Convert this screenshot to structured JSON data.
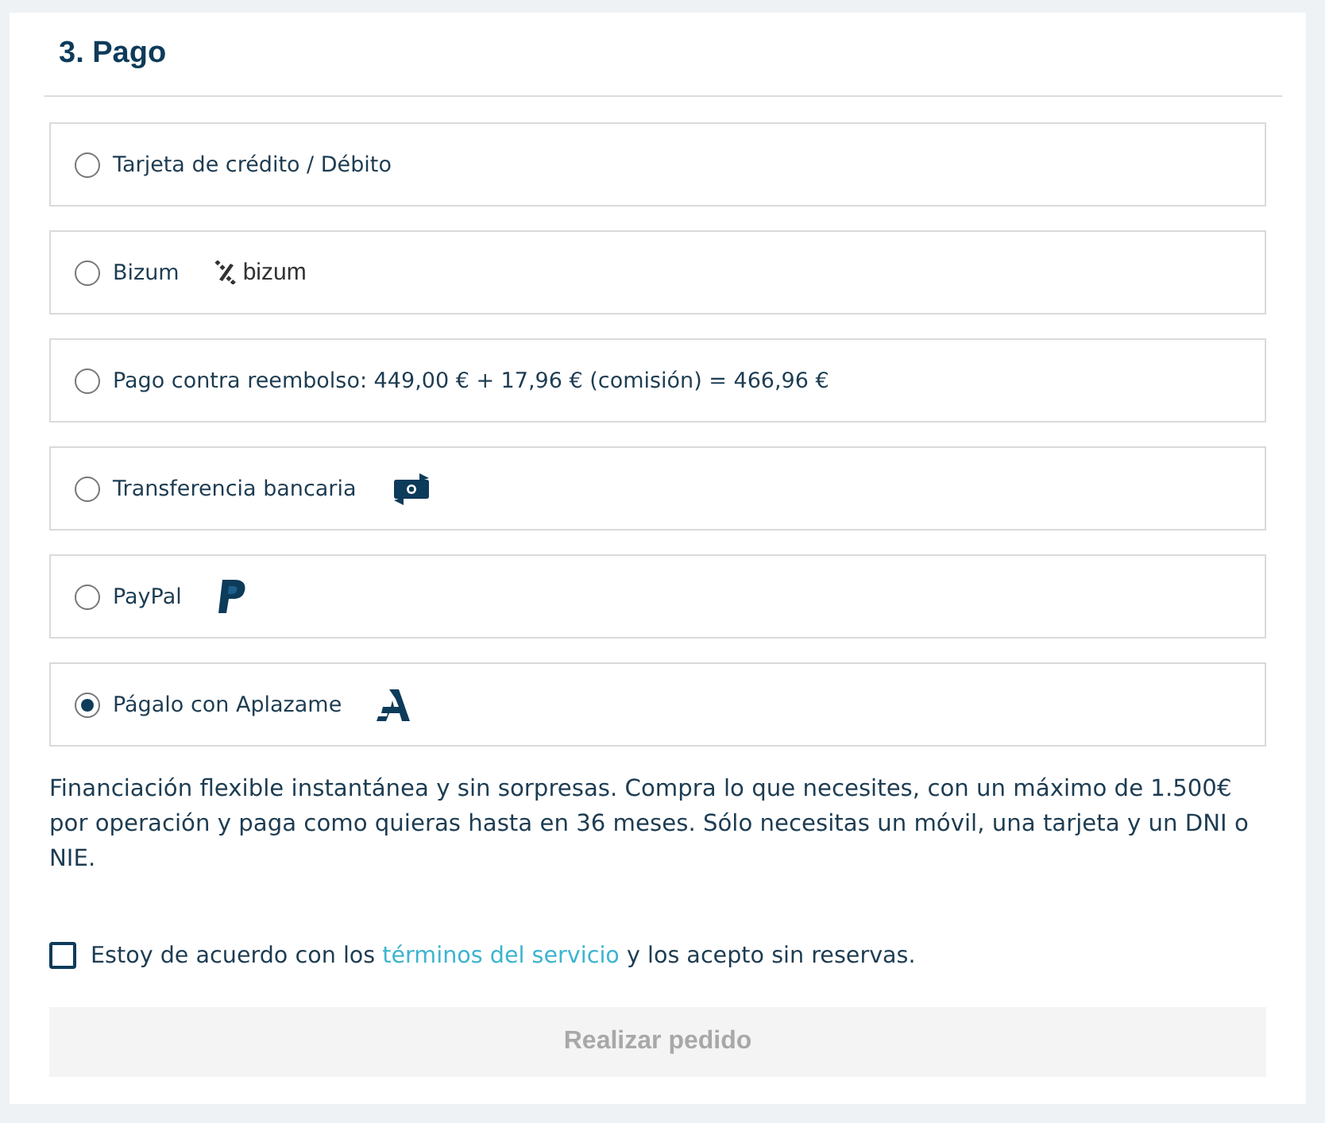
{
  "section": {
    "title": "3. Pago"
  },
  "options": [
    {
      "label": "Tarjeta de crédito / Débito",
      "kind": "none",
      "selected": false
    },
    {
      "label": "Bizum",
      "kind": "bizum",
      "logo_text": "bizum",
      "selected": false
    },
    {
      "label": "Pago contra reembolso: 449,00 € + 17,96 € (comisión) = 466,96 €",
      "kind": "none",
      "selected": false
    },
    {
      "label": "Transferencia bancaria",
      "kind": "transfer",
      "selected": false
    },
    {
      "label": "PayPal",
      "kind": "paypal",
      "selected": false
    },
    {
      "label": "Págalo con Aplazame",
      "kind": "aplazame",
      "selected": true
    }
  ],
  "description": "Financiación flexible instantánea y sin sorpresas. Compra lo que necesites, con un máximo de 1.500€ por operación y paga como quieras hasta en 36 meses. Sólo necesitas un móvil, una tarjeta y un DNI o NIE.",
  "terms": {
    "checked": false,
    "before": "Estoy de acuerdo con los",
    "link": "términos del servicio",
    "after": "y los acepto sin reservas."
  },
  "submit": {
    "label": "Realizar pedido",
    "disabled": true
  }
}
